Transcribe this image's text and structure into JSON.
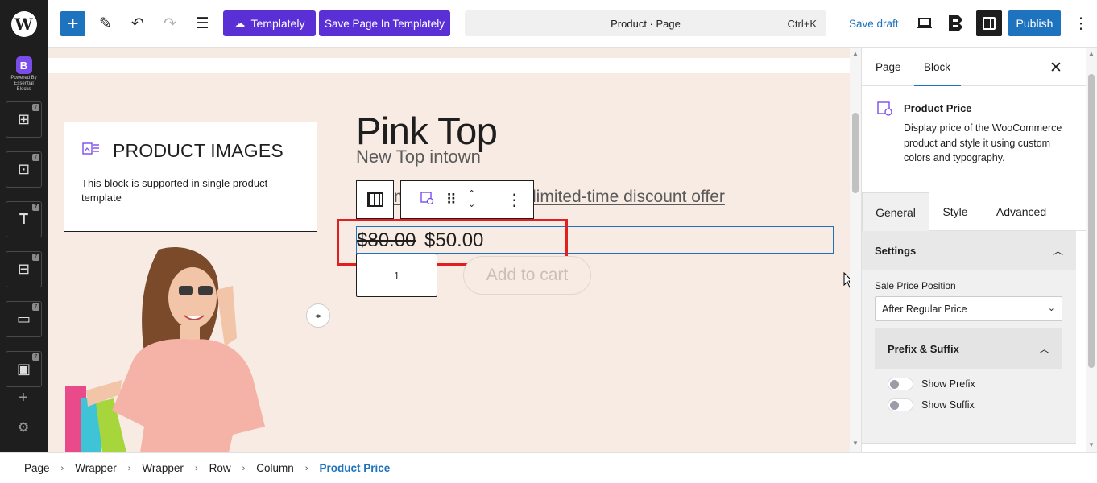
{
  "toolbar": {
    "templately_label": "Templately",
    "save_templately_label": "Save Page In Templately",
    "command_title": "Product · Page",
    "command_shortcut": "Ctrl+K",
    "save_draft_label": "Save draft",
    "publish_label": "Publish"
  },
  "left_panel": {
    "powered_by": "Powered By",
    "essential_blocks": "Essential Blocks",
    "badge": "7"
  },
  "canvas": {
    "product_images_title": "PRODUCT IMAGES",
    "product_images_desc": "This block is supported in single product template",
    "product_title": "Pink Top",
    "product_subtitle": "New Top intown",
    "discount_partial": "m",
    "discount_text": "limited-time discount offer",
    "regular_price": "$80.00",
    "sale_price": "$50.00",
    "quantity": "1",
    "add_to_cart": "Add to cart"
  },
  "sidebar": {
    "tabs": [
      "Page",
      "Block"
    ],
    "block_name": "Product Price",
    "block_desc": "Display price of the WooCommerce product and style it using custom colors and typography.",
    "panel_tabs": [
      "General",
      "Style",
      "Advanced"
    ],
    "settings_label": "Settings",
    "sale_price_position_label": "Sale Price Position",
    "sale_price_position_value": "After Regular Price",
    "prefix_suffix_label": "Prefix & Suffix",
    "show_prefix": "Show Prefix",
    "show_suffix": "Show Suffix"
  },
  "breadcrumb": [
    "Page",
    "Wrapper",
    "Wrapper",
    "Row",
    "Column",
    "Product Price"
  ],
  "colors": {
    "accent": "#1e73be",
    "templately": "#5b2fd6",
    "highlight": "#e02020",
    "page_bg": "#f7ebe3"
  }
}
